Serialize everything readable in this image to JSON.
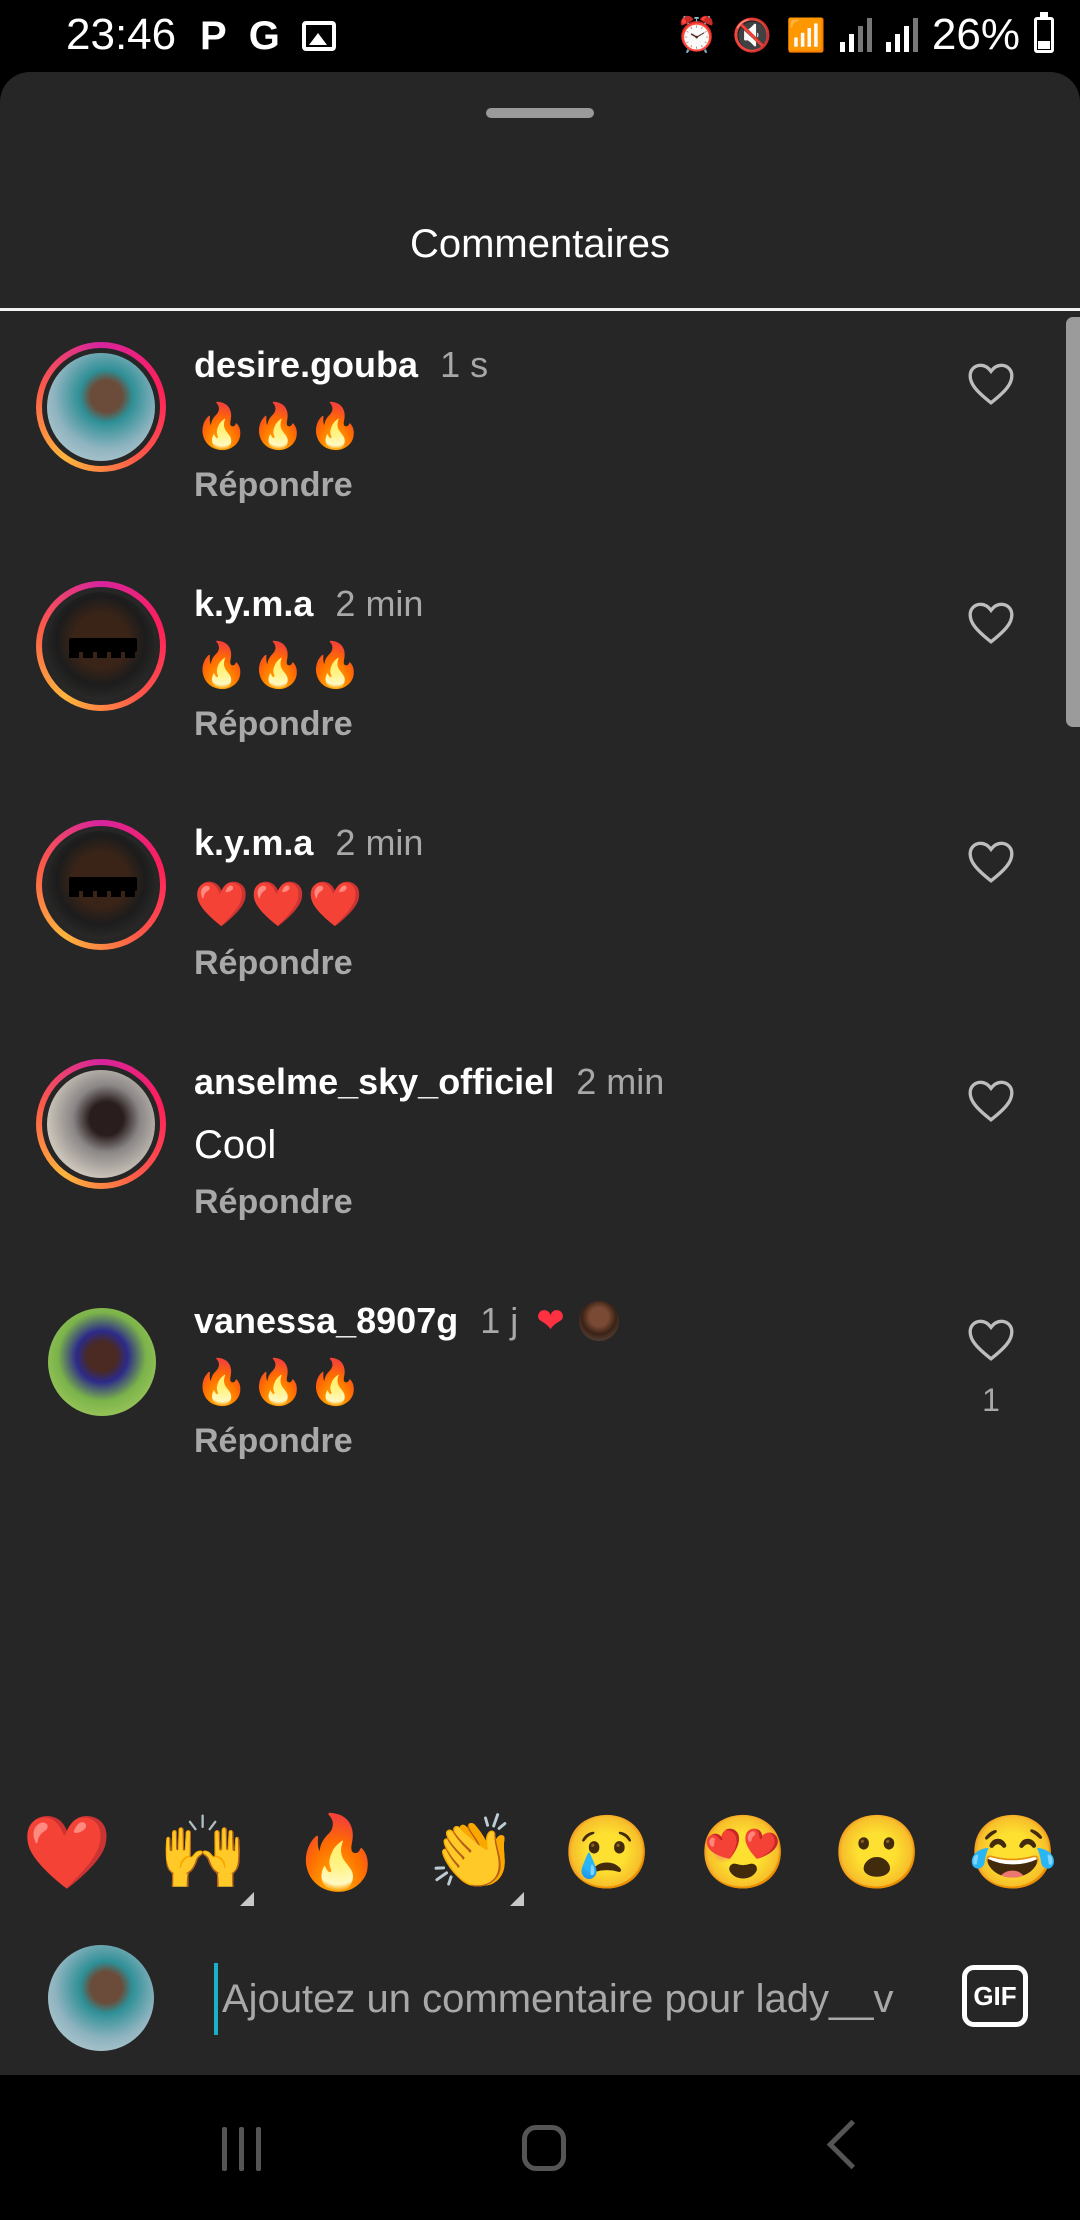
{
  "status_bar": {
    "time": "23:46",
    "left_icons": [
      "P",
      "G"
    ],
    "battery": "26%"
  },
  "header": {
    "title": "Commentaires"
  },
  "comments": [
    {
      "user": "desire.gouba",
      "time": "1 s",
      "content": "🔥🔥🔥",
      "reply": "Répondre"
    },
    {
      "user": "k.y.m.a",
      "time": "2 min",
      "content": "🔥🔥🔥",
      "reply": "Répondre"
    },
    {
      "user": "k.y.m.a",
      "time": "2 min",
      "content": "❤️❤️❤️",
      "reply": "Répondre"
    },
    {
      "user": "anselme_sky_officiel",
      "time": "2 min",
      "content": "Cool",
      "reply": "Répondre"
    },
    {
      "user": "vanessa_8907g",
      "time": "1 j",
      "content": "🔥🔥🔥",
      "reply": "Répondre",
      "likes": "1",
      "author_liked_heart": "❤"
    }
  ],
  "reactions": [
    "❤️",
    "🙌",
    "🔥",
    "👏",
    "😢",
    "😍",
    "😮",
    "😂"
  ],
  "composer": {
    "placeholder": "Ajoutez un commentaire pour lady__v",
    "gif_label": "GIF"
  }
}
